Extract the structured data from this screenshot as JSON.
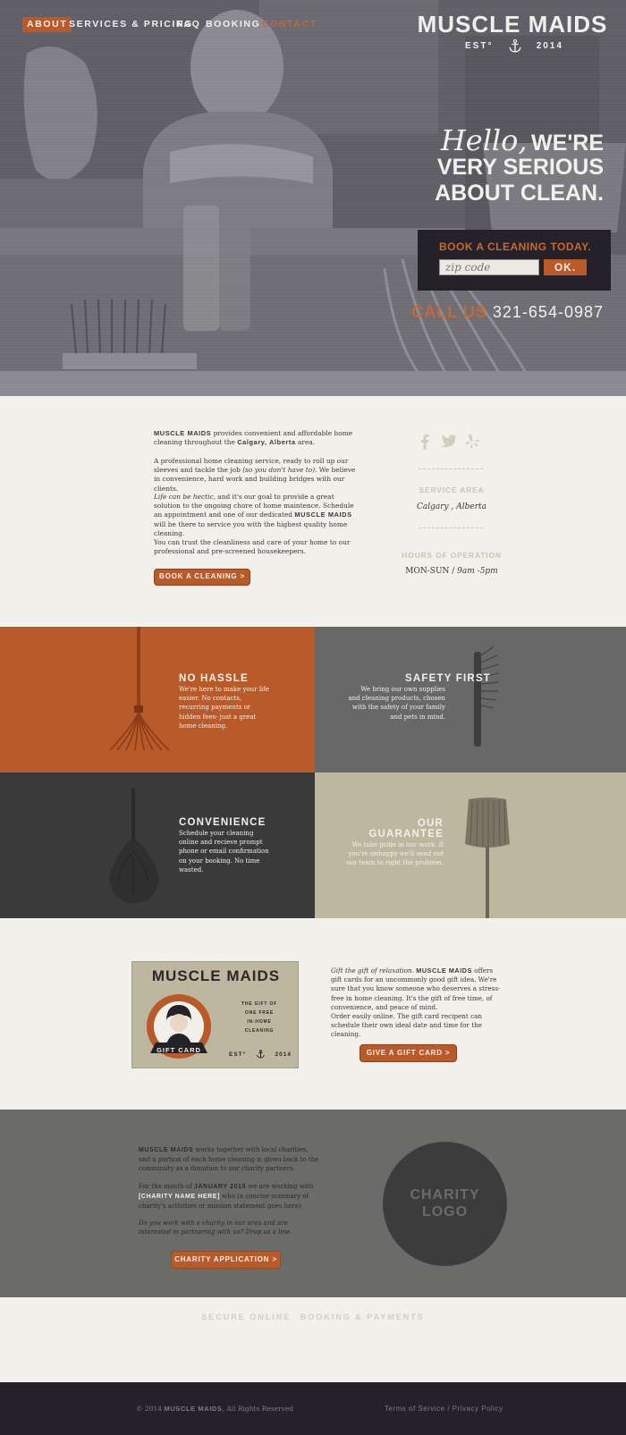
{
  "nav": {
    "about": "ABOUT",
    "services": "SERVICES & PRICING",
    "faq": "FAQ",
    "booking": "BOOKING",
    "contact": "CONTACT"
  },
  "logo": {
    "title": "MUSCLE MAIDS",
    "est": "EST°",
    "year": "2014"
  },
  "hero": {
    "hello": "Hello,",
    "line1": "WE'RE",
    "line2": "VERY SERIOUS",
    "line3": "ABOUT CLEAN."
  },
  "booking_box": {
    "title": "BOOK A CLEANING TODAY.",
    "zip_placeholder": "zip code",
    "ok_label": "OK."
  },
  "call": {
    "label": "CALL US",
    "number": "321-654-0987"
  },
  "about": {
    "brand": "MUSCLE MAIDS",
    "p1_rest": "provides convenient and affordable home cleaning throughout the",
    "p1_city": "Calgary, Alberta",
    "p1_end": "area.",
    "p2_a": "A professional home cleaning service, ready to roll up our sleeves and tackle the job",
    "p2_italic": "(so you don't have to).",
    "p2_b": "We believe in convenience, hard work and building bridges with our clients.",
    "p3_italic": "Life can be hectic,",
    "p3_a": "and it's our goal to provide a great solution to the ongoing chore of home maintence. Schedule an appointment and one of our dedicated",
    "p3_b": "will be there to service you with the highest quality home cleaning.",
    "p4": "You can trust the cleanliness and care of your home to our professional and pre-screened housekeepers.",
    "book_button": "BOOK A CLEANING >"
  },
  "sidebar": {
    "service_area_label": "SERVICE AREA",
    "service_area_value": "Calgary , Alberta",
    "hours_label": "HOURS OF OPERATION",
    "hours_days": "MON-SUN /",
    "hours_time": "9am -5pm",
    "social": [
      "facebook-icon",
      "twitter-icon",
      "yelp-icon"
    ]
  },
  "features": {
    "no_hassle_title": "NO HASSLE",
    "no_hassle_text": "We're here to make your life easier. No contacts, recurring payments or hidden fees- just a great home cleaning.",
    "safety_title": "SAFETY FIRST",
    "safety_text": "We bring our own supplies and cleaning products, chosen with the safety of your family and pets in mind.",
    "convenience_title": "CONVENIENCE",
    "convenience_text": "Schedule your cleaning online and recieve prompt phone or email confirmation on your booking. No time wasted.",
    "guarantee_title_1": "OUR",
    "guarantee_title_2": "GUARANTEE",
    "guarantee_text": "We take pride in our work. If you're unhappy we'll send out our team to right the problem."
  },
  "gift_card": {
    "title": "MUSCLE MAIDS",
    "tag_1": "THE GIFT OF",
    "tag_2": "ONE FREE",
    "tag_3": "IN-HOME",
    "tag_4": "CLEANING",
    "banner": "GIFT CARD",
    "est": "EST°",
    "year": "2014"
  },
  "gift": {
    "p1_italic": "Gift the gift of relaxation.",
    "brand": "MUSCLE MAIDS",
    "p1_rest": "offers gift cards for an uncommonly good gift idea. We're sure that you know someone who deserves a stress-free in home cleaning. It's the gift of free time, of convenience, and peace of mind.",
    "p2": "Order easily online. The gift card recipent can schedule their own ideal date and time for the cleaning.",
    "button": "GIVE A GIFT CARD >"
  },
  "charity": {
    "brand": "MUSCLE MAIDS",
    "p1_rest": "works together with local charities, and a portion of each home cleaning is given back to the community as a donation to our charity partners.",
    "p2_a": "For the month of",
    "p2_month": "JANUARY 2015",
    "p2_b": "we are working with",
    "p2_name": "[CHARITY NAME HERE]",
    "p2_c": "who (a concise summary of charity's activities or mission statement goes here).",
    "p3_italic": "Do you work with a charity in our area and are interested in partnering with us? Drop us a line.",
    "button": "CHARITY APPLICATION >",
    "logo_1": "CHARITY",
    "logo_2": "LOGO"
  },
  "secure": {
    "text_1": "SECURE ONLINE",
    "text_2": "BOOKING & PAYMENTS"
  },
  "footer": {
    "copyright": "© 2014",
    "brand": "MUSCLE MAIDS",
    "rights": ", All Rights Reserved",
    "terms": "Terms of Service",
    "separator": "/",
    "privacy": "Privacy Policy"
  },
  "colors": {
    "accent": "#b85a2a",
    "dark": "#242228",
    "cream": "#f2f0eb",
    "gray": "#6b6b69",
    "tan": "#bdb7a0"
  }
}
